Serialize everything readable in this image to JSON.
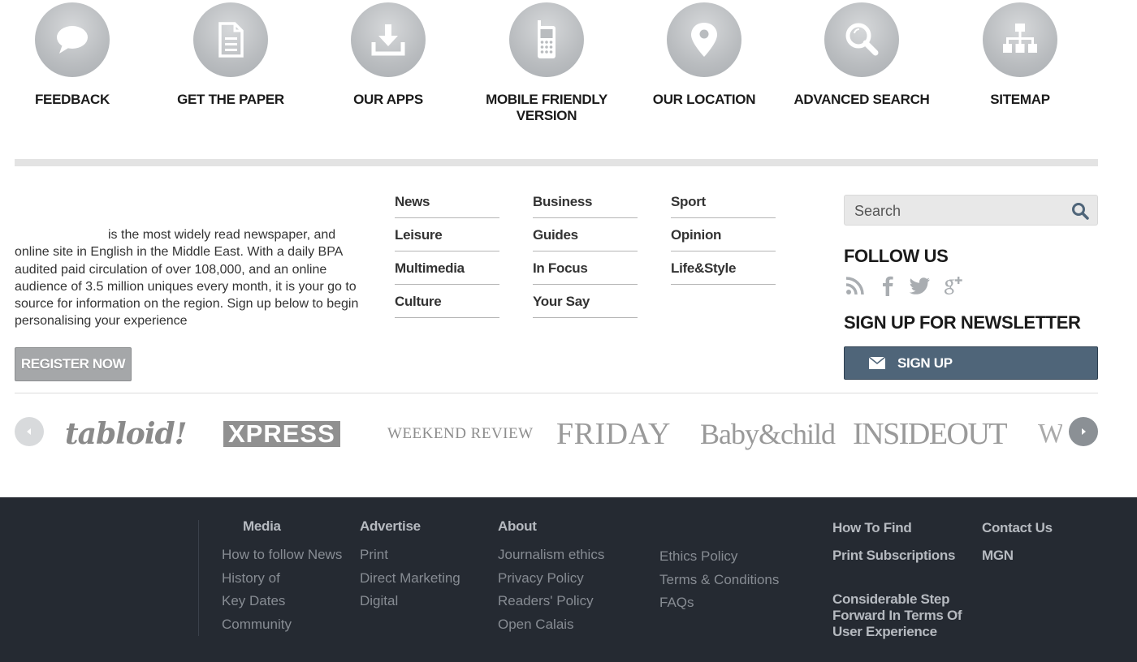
{
  "quick_links": [
    {
      "label": "FEEDBACK",
      "icon": "speech-bubble-icon"
    },
    {
      "label": "GET THE PAPER",
      "icon": "document-icon"
    },
    {
      "label": "OUR APPS",
      "icon": "download-icon"
    },
    {
      "label": "MOBILE FRIENDLY VERSION",
      "icon": "mobile-phone-icon"
    },
    {
      "label": "OUR LOCATION",
      "icon": "map-pin-icon"
    },
    {
      "label": "ADVANCED SEARCH",
      "icon": "magnifier-icon"
    },
    {
      "label": "SITEMAP",
      "icon": "sitemap-icon"
    }
  ],
  "about": {
    "text": "is the most widely read newspaper, and online site in English in the Middle East. With a daily BPA audited paid circulation of over 108,000, and an online audience of 3.5 million uniques every month, it is your go to source for information on the region. Sign up below to begin personalising your experience",
    "register_label": "REGISTER NOW"
  },
  "sections": {
    "col1": [
      "News",
      "Leisure",
      "Multimedia",
      "Culture"
    ],
    "col2": [
      "Business",
      "Guides",
      "In Focus",
      "Your Say"
    ],
    "col3": [
      "Sport",
      "Opinion",
      "Life&Style"
    ]
  },
  "search": {
    "placeholder": "Search"
  },
  "follow": {
    "title": "FOLLOW US",
    "icons": [
      "rss-icon",
      "facebook-icon",
      "twitter-icon",
      "google-plus-icon"
    ]
  },
  "newsletter": {
    "title": "SIGN UP FOR NEWSLETTER",
    "button_label": "SIGN UP"
  },
  "brands": [
    "tabloid!",
    "XPRESS",
    "WEEKEND REVIEW",
    "FRIDAY",
    "Baby&child",
    "INSIDEOUT",
    "Wat"
  ],
  "footer": {
    "media": {
      "heading": "Media",
      "links": [
        "How to follow News",
        "History of",
        "Key Dates",
        "Community"
      ]
    },
    "advertise": {
      "heading": "Advertise",
      "links": [
        "Print",
        "Direct Marketing",
        "Digital"
      ]
    },
    "about": {
      "heading": "About",
      "links": [
        "Journalism ethics",
        "Privacy Policy",
        "Readers' Policy",
        "Open Calais"
      ]
    },
    "policies": {
      "links": [
        "Ethics Policy",
        "Terms & Conditions",
        "FAQs"
      ]
    },
    "right": {
      "how_to_find": "How To Find",
      "contact_us": "Contact Us",
      "print_subscriptions": "Print Subscriptions",
      "mgn": "MGN",
      "considerable_step": "Considerable Step Forward In Terms Of User Experience"
    }
  },
  "colors": {
    "icon_circle": "#b9bcbf",
    "signup_button": "#4f6579",
    "register_button": "#a5a7a9",
    "footer_bg": "#252a32"
  }
}
